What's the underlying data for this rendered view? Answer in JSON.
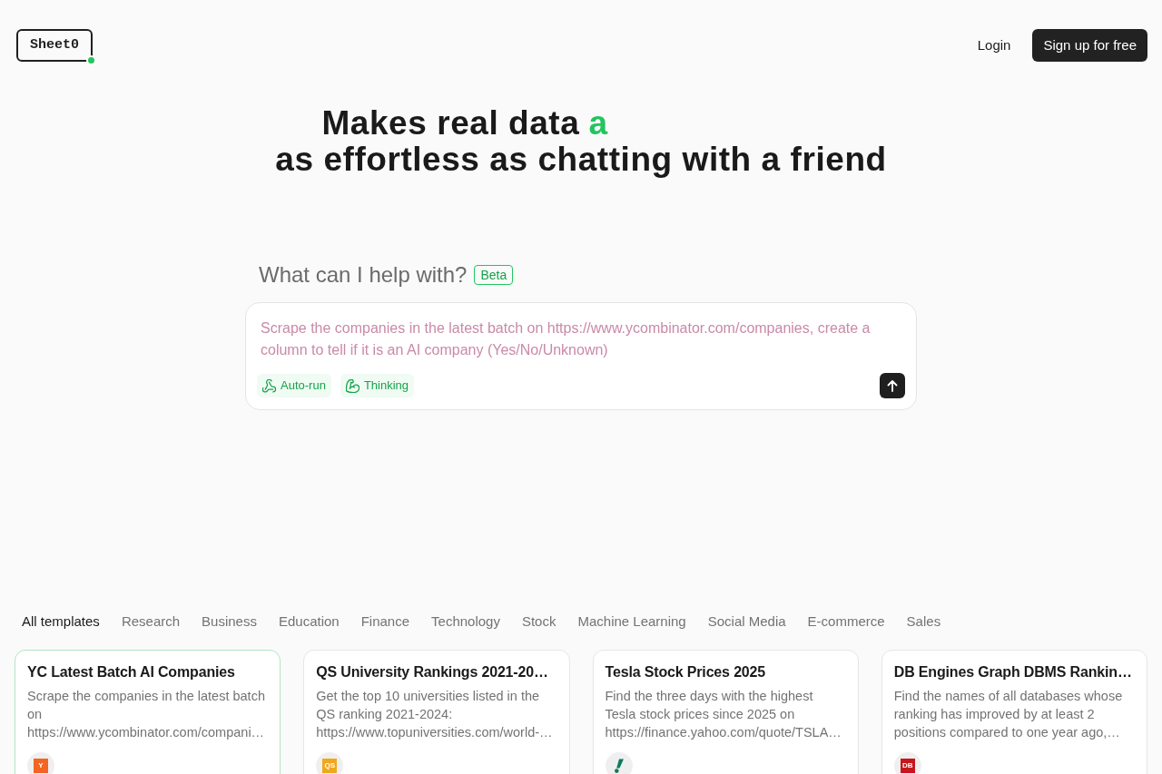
{
  "header": {
    "logo": "Sheet0",
    "login": "Login",
    "signup": "Sign up for free"
  },
  "hero": {
    "lead": "Makes real data",
    "highlight": "a",
    "line2": "as effortless as chatting with a friend"
  },
  "prompt": {
    "heading": "What can I help with?",
    "badge": "Beta",
    "placeholder": "Scrape the companies in the latest batch on https://www.ycombinator.com/companies, create a column to tell if it is an AI company (Yes/No/Unknown)",
    "toggles": [
      {
        "kind": "autorun",
        "label": "Auto-run",
        "on": true
      },
      {
        "kind": "thinking",
        "label": "Thinking",
        "on": true
      }
    ]
  },
  "categories": [
    {
      "label": "All templates",
      "selected": true
    },
    {
      "label": "Research",
      "selected": false
    },
    {
      "label": "Business",
      "selected": false
    },
    {
      "label": "Education",
      "selected": false
    },
    {
      "label": "Finance",
      "selected": false
    },
    {
      "label": "Technology",
      "selected": false
    },
    {
      "label": "Stock",
      "selected": false
    },
    {
      "label": "Machine Learning",
      "selected": false
    },
    {
      "label": "Social Media",
      "selected": false
    },
    {
      "label": "E-commerce",
      "selected": false
    },
    {
      "label": "Sales",
      "selected": false
    }
  ],
  "templates": [
    {
      "title": "YC Latest Batch AI Companies",
      "description": "Scrape the companies in the latest batch on https://www.ycombinator.com/compani…",
      "selected": true,
      "logo": {
        "kind": "letters",
        "text": "Y",
        "color": "#f26522"
      }
    },
    {
      "title": "QS University Rankings 2021-20…",
      "description": "Get the top 10 universities listed in the QS ranking 2021-2024: https://www.topuniversities.com/world-…",
      "selected": false,
      "logo": {
        "kind": "letters",
        "text": "QS",
        "color": "#f0a81c"
      }
    },
    {
      "title": "Tesla Stock Prices 2025",
      "description": "Find the three days with the highest Tesla stock prices since 2025 on https://finance.yahoo.com/quote/TSLA…",
      "selected": false,
      "logo": {
        "kind": "mark",
        "color": "#0f7a5c"
      }
    },
    {
      "title": "DB Engines Graph DBMS Rankin…",
      "description": "Find the names of all databases whose ranking has improved by at least 2 positions compared to one year ago,…",
      "selected": false,
      "logo": {
        "kind": "letters",
        "text": "DB",
        "color": "#c8161d"
      }
    }
  ]
}
